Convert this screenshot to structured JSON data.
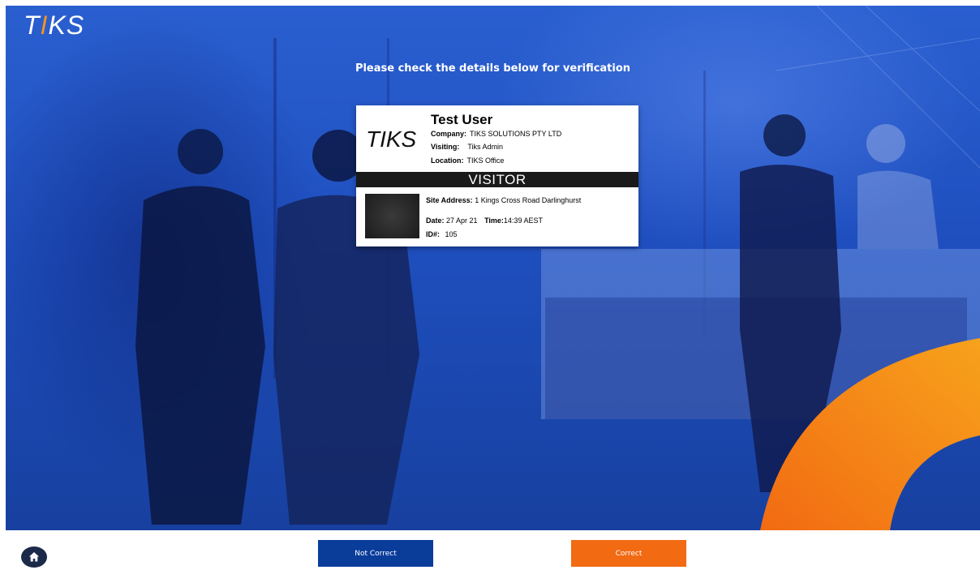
{
  "app": {
    "logo_text_pre": "T",
    "logo_text_accent": "I",
    "logo_text_post": "KS"
  },
  "instruction": "Please check the details below for verification",
  "badge": {
    "logo": "TIKS",
    "name": "Test User",
    "company_label": "Company:",
    "company_value": "TIKS SOLUTIONS PTY LTD",
    "visiting_label": "Visiting:",
    "visiting_value": "Tiks Admin",
    "location_label": "Location:",
    "location_value": "TIKS Office",
    "role": "VISITOR",
    "site_address_label": "Site Address:",
    "site_address_value": "1 Kings Cross Road Darlinghurst",
    "date_label": "Date:",
    "date_value": "27 Apr 21",
    "time_label": "Time:",
    "time_value": "14:39 AEST",
    "id_label": "ID#:",
    "id_value": "105"
  },
  "footer": {
    "home_icon": "home-icon",
    "not_correct_label": "Not Correct",
    "correct_label": "Correct"
  },
  "colors": {
    "background_blue": "#1f4fbf",
    "not_correct_button": "#0a3c9a",
    "correct_button": "#f26a12",
    "accent_orange": "#f7941d",
    "home_button": "#1c2a4a"
  }
}
